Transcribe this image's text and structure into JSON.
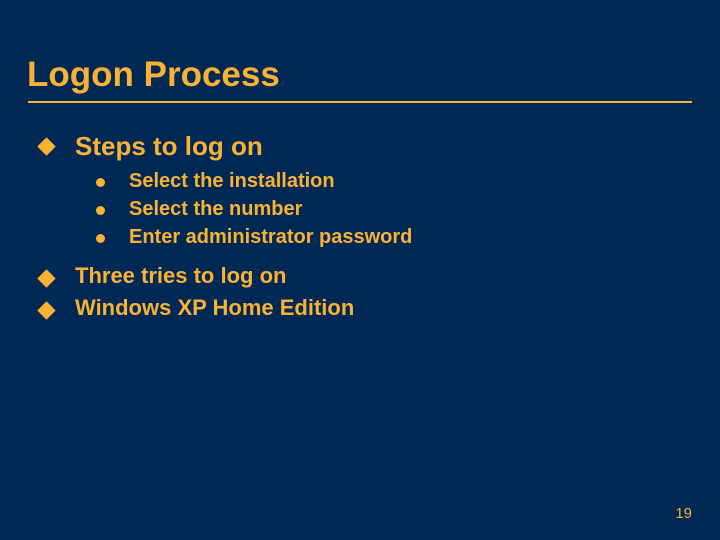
{
  "title": "Logon Process",
  "bullets": [
    {
      "text": "Steps to log on",
      "heading": true
    },
    {
      "text": "Three tries to log on",
      "heading": false
    },
    {
      "text": "Windows XP Home Edition",
      "heading": false
    }
  ],
  "sub_bullets": [
    "Select the installation",
    "Select the number",
    "Enter administrator password"
  ],
  "page_number": "19"
}
